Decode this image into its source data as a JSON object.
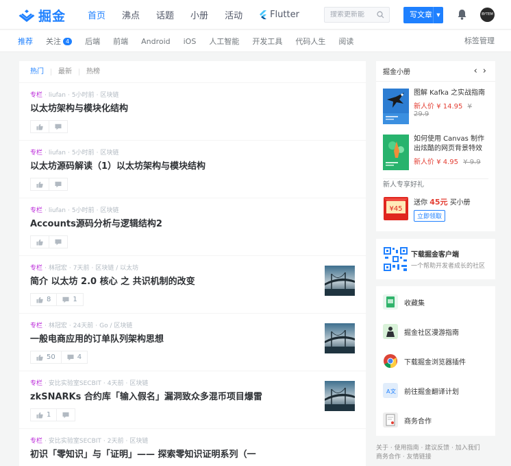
{
  "header": {
    "logo_text": "掘金",
    "nav": [
      "首页",
      "沸点",
      "话题",
      "小册",
      "活动",
      "Flutter"
    ],
    "active_nav": 0,
    "search_placeholder": "搜索更新能",
    "write_label": "写文章",
    "avatar_text": "BYTEM"
  },
  "subnav": {
    "tags": [
      {
        "label": "推荐",
        "active": true
      },
      {
        "label": "关注",
        "badge": "4"
      },
      {
        "label": "后端"
      },
      {
        "label": "前端"
      },
      {
        "label": "Android"
      },
      {
        "label": "iOS"
      },
      {
        "label": "人工智能"
      },
      {
        "label": "开发工具"
      },
      {
        "label": "代码人生"
      },
      {
        "label": "阅读"
      }
    ],
    "manage_label": "标签管理"
  },
  "feed": {
    "tabs": [
      "热门",
      "最新",
      "热榜"
    ],
    "entries": [
      {
        "category": "专栏",
        "author": "liufan",
        "time": "5小时前",
        "tags": "区块链",
        "title": "以太坊架构与模块化结构",
        "likes": "",
        "comments": "",
        "thumb": false
      },
      {
        "category": "专栏",
        "author": "liufan",
        "time": "5小时前",
        "tags": "区块链",
        "title": "以太坊源码解读（1）以太坊架构与模块结构",
        "likes": "",
        "comments": "",
        "thumb": false
      },
      {
        "category": "专栏",
        "author": "liufan",
        "time": "5小时前",
        "tags": "区块链",
        "title": "Accounts源码分析与逻辑结构2",
        "likes": "",
        "comments": "",
        "thumb": false
      },
      {
        "category": "专栏",
        "author": "林冠宏",
        "time": "7天前",
        "tags": "区块链 / 以太坊",
        "title": "简介 以太坊 2.0 核心 之 共识机制的改变",
        "likes": "8",
        "comments": "1",
        "thumb": true
      },
      {
        "category": "专栏",
        "author": "林冠宏",
        "time": "24天前",
        "tags": "Go / 区块链",
        "title": "一般电商应用的订单队列架构思想",
        "likes": "50",
        "comments": "4",
        "thumb": true
      },
      {
        "category": "专栏",
        "author": "安比实验室SECBIT",
        "time": "4天前",
        "tags": "区块链",
        "title": "zkSNARKs 合约库「输入假名」漏洞致众多混币项目爆雷",
        "likes": "1",
        "comments": "",
        "thumb": true
      },
      {
        "category": "专栏",
        "author": "安比实验室SECBIT",
        "time": "2天前",
        "tags": "区块链",
        "title": "初识「零知识」与「证明」—— 探索零知识证明系列（一",
        "likes": "",
        "comments": "",
        "thumb": false
      }
    ]
  },
  "sidebar": {
    "books": {
      "title": "掘金小册",
      "items": [
        {
          "title": "图解 Kafka 之实战指南",
          "price_label": "新人价",
          "price": "¥ 14.95",
          "old_price": "¥ 29.9"
        },
        {
          "title": "如何使用 Canvas 制作出炫酷的网页背景特效",
          "price_label": "新人价",
          "price": "¥ 4.95",
          "old_price": "¥ 9.9"
        }
      ],
      "newbie_label": "新人专享好礼",
      "gift": {
        "coupon": "¥45",
        "prefix": "送你",
        "amount": "45元",
        "suffix": "买小册",
        "claim_label": "立即领取"
      }
    },
    "app": {
      "title": "下载掘金客户端",
      "subtitle": "一个帮助开发者成长的社区"
    },
    "links": [
      "收藏集",
      "掘金社区漫游指南",
      "下载掘金浏览器插件",
      "前往掘金翻译计划",
      "商务合作"
    ],
    "footer_lines": [
      "关于 · 使用指南 · 建议反馈 · 加入我们",
      "商务合作 · 友情链接"
    ]
  },
  "colors": {
    "brand": "#1e80ff",
    "category": "#b71ed7",
    "price": "#e33e33"
  }
}
